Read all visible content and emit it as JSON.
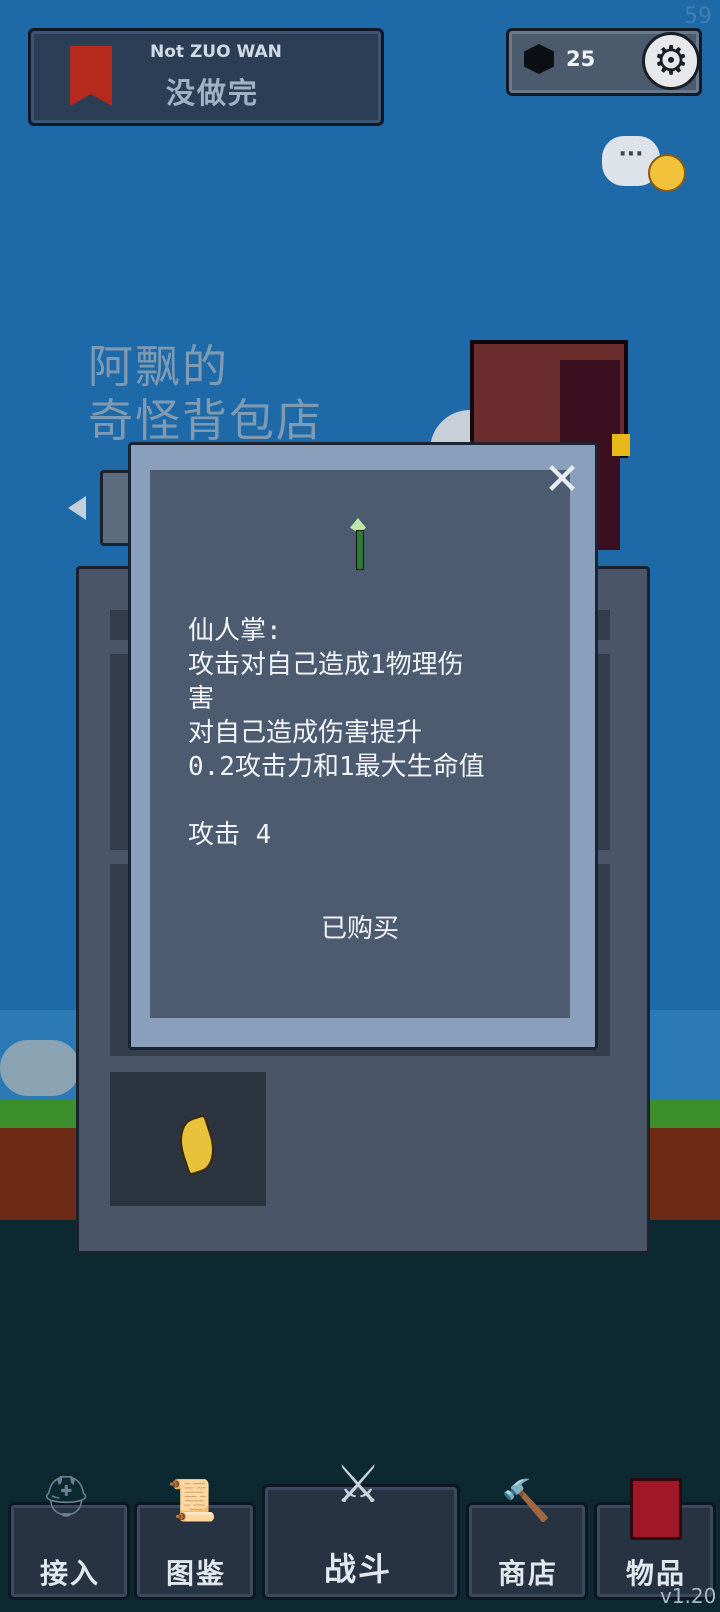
{
  "status": {
    "fps": "59",
    "version": "v1.20"
  },
  "banner": {
    "subtitle": "Not ZUO WAN",
    "title": "没做完"
  },
  "currency": {
    "gems": "25"
  },
  "shop": {
    "title_line1": "阿飘的",
    "title_line2": "奇怪背包店"
  },
  "modal": {
    "lines": [
      "仙人掌:",
      "攻击对自己造成1物理伤",
      "害",
      "对自己造成伤害提升",
      "0.2攻击力和1最大生命值",
      "",
      "攻击 4"
    ],
    "status_label": "已购买",
    "close_label": "✕"
  },
  "chat": {
    "dots": "···"
  },
  "nav": [
    {
      "label": "接入",
      "icon": "helmet-icon"
    },
    {
      "label": "图鉴",
      "icon": "scroll-icon"
    },
    {
      "label": "战斗",
      "icon": "crossed-swords-icon"
    },
    {
      "label": "商店",
      "icon": "hammer-icon"
    },
    {
      "label": "物品",
      "icon": "spellbook-icon"
    }
  ],
  "colors": {
    "sky": "#1e6aa8",
    "modal_bg": "#4c5b70",
    "accent_red": "#b52a1d"
  }
}
